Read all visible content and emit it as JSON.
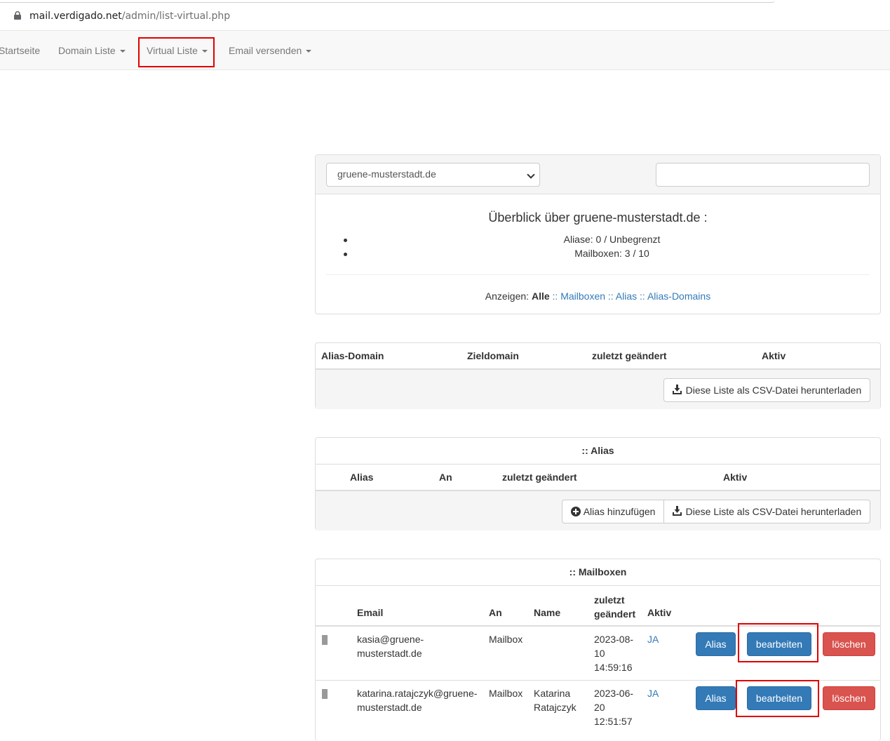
{
  "browser": {
    "url_host": "mail.verdigado.net",
    "url_path": "/admin/list-virtual.php",
    "lock_icon": "lock-icon"
  },
  "nav": {
    "items": [
      {
        "label": "Startseite",
        "dropdown": false
      },
      {
        "label": "Domain Liste",
        "dropdown": true
      },
      {
        "label": "Virtual Liste",
        "dropdown": true
      },
      {
        "label": "Email versenden",
        "dropdown": true
      }
    ]
  },
  "filter": {
    "domain_selected": "gruene-musterstadt.de",
    "search_value": ""
  },
  "overview": {
    "title": "Überblick über gruene-musterstadt.de :",
    "stats": [
      "Aliase: 0 / Unbegrenzt",
      "Mailboxen: 3 / 10"
    ],
    "show_label": "Anzeigen:",
    "show_all": "Alle",
    "show_mailboxes": ":: Mailboxen",
    "show_alias": ":: Alias",
    "show_alias_domains": ":: Alias-Domains"
  },
  "alias_domains": {
    "headers": [
      "Alias-Domain",
      "Zieldomain",
      "zuletzt geändert",
      "Aktiv"
    ],
    "csv_button": "Diese Liste als CSV-Datei herunterladen"
  },
  "alias": {
    "title": ":: Alias",
    "headers": [
      "Alias",
      "An",
      "zuletzt geändert",
      "Aktiv"
    ],
    "add_button": "Alias hinzufügen",
    "csv_button": "Diese Liste als CSV-Datei herunterladen"
  },
  "mailboxes": {
    "title": ":: Mailboxen",
    "headers": {
      "email": "Email",
      "an": "An",
      "name": "Name",
      "changed_1": "zuletzt",
      "changed_2": "geändert",
      "aktiv": "Aktiv"
    },
    "rows": [
      {
        "email_1": "kasia@gruene-",
        "email_2": "musterstadt.de",
        "an": "Mailbox",
        "name_1": "",
        "name_2": "",
        "date_1": "2023-08-",
        "date_2": "10",
        "date_3": "14:59:16",
        "aktiv": "JA",
        "alias_btn": "Alias",
        "edit_btn": "bearbeiten",
        "delete_btn": "löschen"
      },
      {
        "email_1": "katarina.ratajczyk@gruene-",
        "email_2": "musterstadt.de",
        "an": "Mailbox",
        "name_1": "Katarina",
        "name_2": "Ratajczyk",
        "date_1": "2023-06-",
        "date_2": "20",
        "date_3": "12:51:57",
        "aktiv": "JA",
        "alias_btn": "Alias",
        "edit_btn": "bearbeiten",
        "delete_btn": "löschen"
      }
    ]
  },
  "colors": {
    "highlight": "#e00000",
    "primary": "#337ab7",
    "danger": "#d9534f"
  }
}
